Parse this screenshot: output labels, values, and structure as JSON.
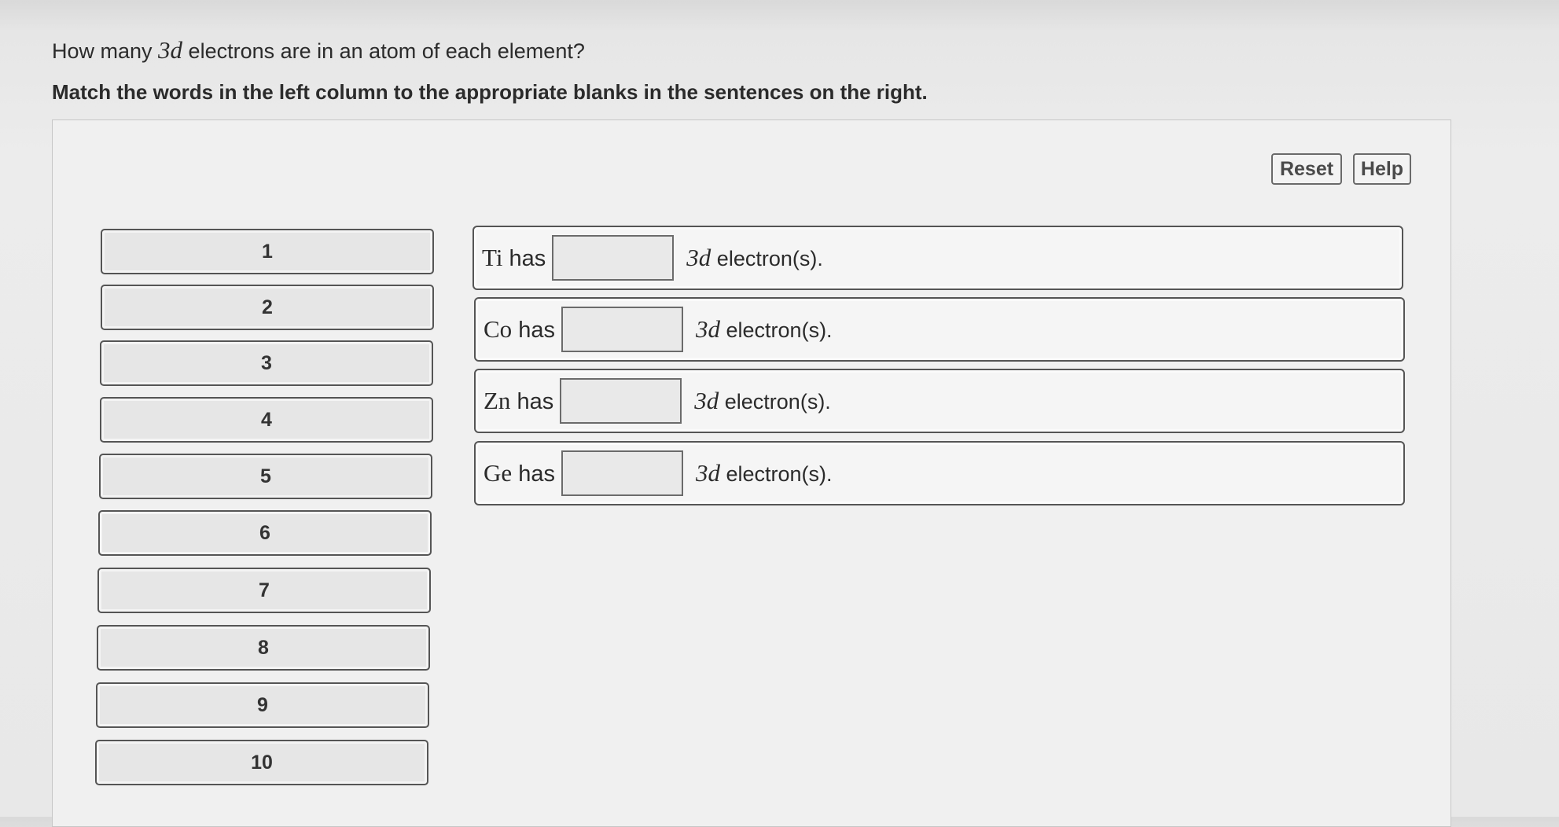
{
  "question": {
    "prefix": "How many ",
    "math": "3d",
    "suffix": " electrons are in an atom of each element?"
  },
  "instruction": "Match the words in the left column to the appropriate blanks in the sentences on the right.",
  "toolbar": {
    "reset_label": "Reset",
    "help_label": "Help"
  },
  "word_bank": [
    "1",
    "2",
    "3",
    "4",
    "5",
    "6",
    "7",
    "8",
    "9",
    "10"
  ],
  "sentences": [
    {
      "element": "Ti",
      "has": " has",
      "math": "3d",
      "suffix": " electron(s).",
      "blank_value": ""
    },
    {
      "element": "Co",
      "has": " has",
      "math": "3d",
      "suffix": " electron(s).",
      "blank_value": ""
    },
    {
      "element": "Zn",
      "has": " has",
      "math": "3d",
      "suffix": " electron(s).",
      "blank_value": ""
    },
    {
      "element": "Ge",
      "has": " has",
      "math": "3d",
      "suffix": " electron(s).",
      "blank_value": ""
    }
  ]
}
